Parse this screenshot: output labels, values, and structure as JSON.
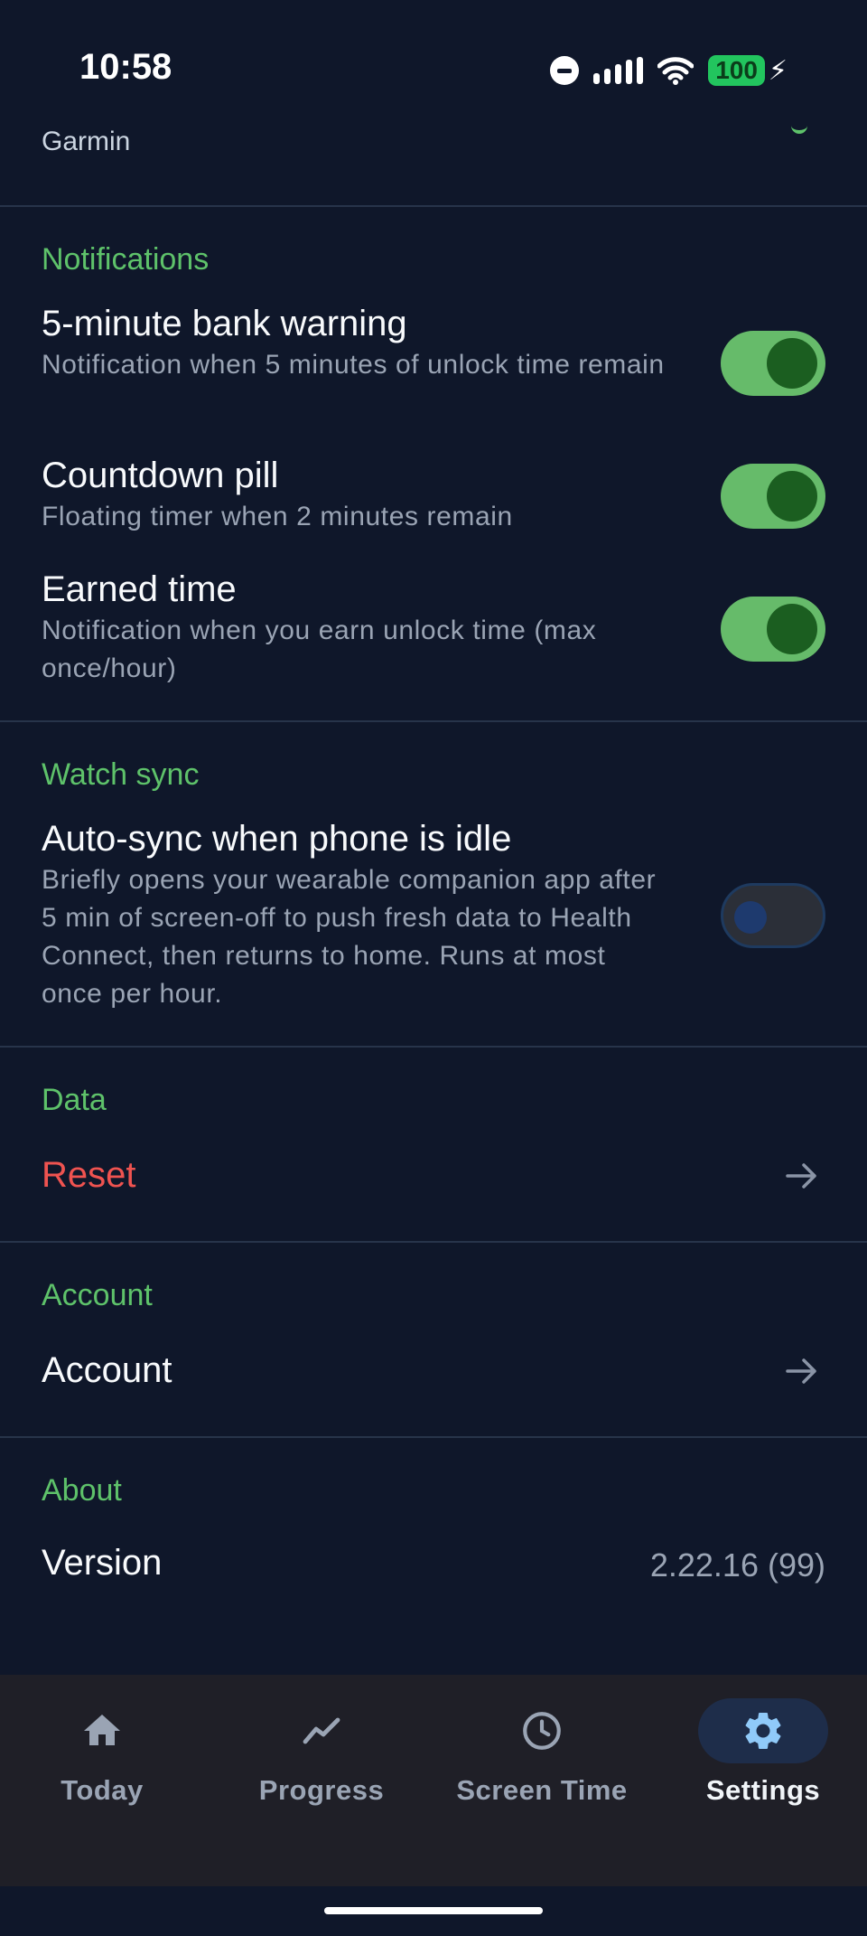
{
  "status_bar": {
    "time": "10:58",
    "battery": "100"
  },
  "previous_row": {
    "label": "Garmin"
  },
  "notifications": {
    "section_title": "Notifications",
    "items": [
      {
        "title": "5-minute bank warning",
        "description": "Notification when 5 minutes of unlock time remain",
        "enabled": true
      },
      {
        "title": "Countdown pill",
        "description": "Floating timer when 2 minutes remain",
        "enabled": true
      },
      {
        "title": "Earned time",
        "description": "Notification when you earn unlock time (max once/hour)",
        "enabled": true
      }
    ]
  },
  "watch_sync": {
    "section_title": "Watch sync",
    "item": {
      "title": "Auto-sync when phone is idle",
      "description": "Briefly opens your wearable companion app after 5 min of screen-off to push fresh data to Health Connect, then returns to home. Runs at most once per hour.",
      "enabled": false
    }
  },
  "data_section": {
    "section_title": "Data",
    "reset_label": "Reset"
  },
  "account_section": {
    "section_title": "Account",
    "account_label": "Account"
  },
  "about_section": {
    "section_title": "About",
    "version_label": "Version",
    "version_value": "2.22.16 (99)"
  },
  "bottom_nav": {
    "items": [
      {
        "label": "Today",
        "icon": "home-icon"
      },
      {
        "label": "Progress",
        "icon": "trend-icon"
      },
      {
        "label": "Screen Time",
        "icon": "clock-icon"
      },
      {
        "label": "Settings",
        "icon": "gear-icon",
        "active": true
      }
    ]
  },
  "colors": {
    "background": "#0f172a",
    "accent": "#5ec26a",
    "danger": "#ef5350",
    "nav_background": "#1f1f27"
  }
}
